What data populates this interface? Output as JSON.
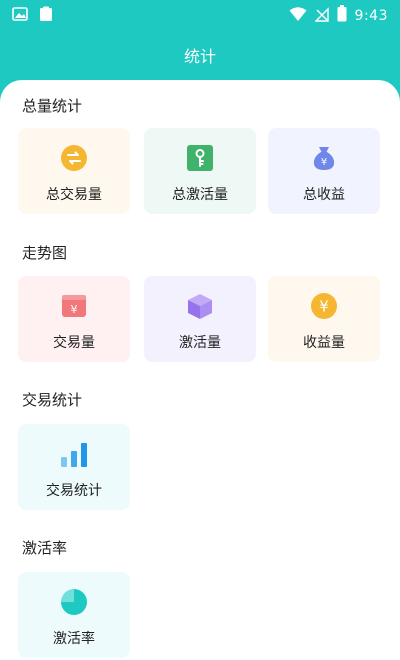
{
  "status_bar": {
    "time": "9:43"
  },
  "header": {
    "title": "统计"
  },
  "sections": [
    {
      "title": "总量统计",
      "cards": [
        {
          "label": "总交易量",
          "icon": "exchange-coin-icon"
        },
        {
          "label": "总激活量",
          "icon": "key-icon"
        },
        {
          "label": "总收益",
          "icon": "money-bag-icon"
        }
      ]
    },
    {
      "title": "走势图",
      "cards": [
        {
          "label": "交易量",
          "icon": "yuan-box-icon"
        },
        {
          "label": "激活量",
          "icon": "cube-icon"
        },
        {
          "label": "收益量",
          "icon": "yuan-coin-icon"
        }
      ]
    },
    {
      "title": "交易统计",
      "cards": [
        {
          "label": "交易统计",
          "icon": "bar-chart-icon"
        }
      ]
    },
    {
      "title": "激活率",
      "cards": [
        {
          "label": "激活率",
          "icon": "pie-chart-icon"
        }
      ]
    }
  ],
  "colors": {
    "primary": "#1ec9c2",
    "card_orange_bg": "#fff8ef",
    "card_green_bg": "#eef8f4",
    "card_blue_bg": "#f1f4ff",
    "card_pink_bg": "#fff1f1",
    "card_purple_bg": "#f4f1ff",
    "card_cyan_bg": "#eefbfd"
  }
}
